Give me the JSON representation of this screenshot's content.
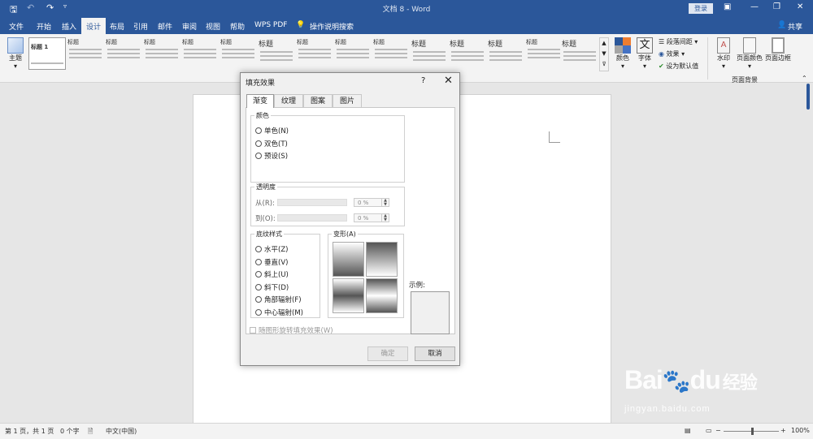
{
  "titlebar": {
    "doc_title": "文档 8  -  Word",
    "login_label": "登录",
    "save_icon": "save-icon",
    "undo_icon": "undo-icon",
    "redo_icon": "redo-icon",
    "customize_icon": "customize-icon"
  },
  "tabs": [
    "文件",
    "开始",
    "插入",
    "设计",
    "布局",
    "引用",
    "邮件",
    "审阅",
    "视图",
    "帮助",
    "WPS PDF"
  ],
  "active_tab": "设计",
  "tell_me": "操作说明搜索",
  "share_label": "共享",
  "ribbon": {
    "theme_label": "主题",
    "style_set_heading": "标题",
    "style_set_first": "标题 1",
    "colors_label": "颜色",
    "fonts_label": "字体",
    "paragraph_spacing": "段落间距",
    "effects": "效果",
    "set_default": "设为默认值",
    "watermark": "水印",
    "page_color": "页面颜色",
    "page_border": "页面边框",
    "group_page_background": "页面背景"
  },
  "dialog": {
    "title": "填充效果",
    "help": "?",
    "close": "✕",
    "tabs": [
      "渐变",
      "纹理",
      "图案",
      "图片"
    ],
    "active_tab": "渐变",
    "colors_legend": "颜色",
    "color_options": [
      "单色(N)",
      "双色(T)",
      "预设(S)"
    ],
    "transparency_legend": "透明度",
    "from_label": "从(R):",
    "to_label": "到(O):",
    "from_value": "0 %",
    "to_value": "0 %",
    "shading_legend": "底纹样式",
    "shading_options": [
      "水平(Z)",
      "垂直(V)",
      "斜上(U)",
      "斜下(D)",
      "角部辐射(F)",
      "中心辐射(M)"
    ],
    "variants_label": "变形(A)",
    "sample_label": "示例:",
    "rotate_checkbox": "随图形旋转填充效果(W)",
    "ok_label": "确定",
    "cancel_label": "取消"
  },
  "statusbar": {
    "page": "第 1 页，共 1 页",
    "words": "0 个字",
    "language": "中文(中国)",
    "zoom": "100%"
  },
  "watermark": {
    "brand": "Bai",
    "brand2": "du",
    "cn": "经验",
    "url": "jingyan.baidu.com"
  }
}
